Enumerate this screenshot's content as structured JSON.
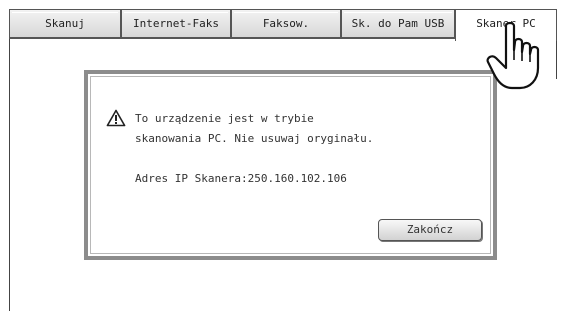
{
  "tabs": [
    {
      "label": "Skanuj",
      "active": false
    },
    {
      "label": "Internet-Faks",
      "active": false
    },
    {
      "label": "Faksow.",
      "active": false
    },
    {
      "label": "Sk. do Pam USB",
      "active": false
    },
    {
      "label": "Skaner PC",
      "active": true
    }
  ],
  "dialog": {
    "message_line1": "To urządzenie jest w trybie",
    "message_line2": "skanowania PC. Nie usuwaj oryginału.",
    "ip_line": "Adres IP Skanera:250.160.102.106",
    "finish_button": "Zakończ",
    "icon": "warning-icon"
  },
  "pointer": {
    "icon": "pointing-hand-icon"
  }
}
